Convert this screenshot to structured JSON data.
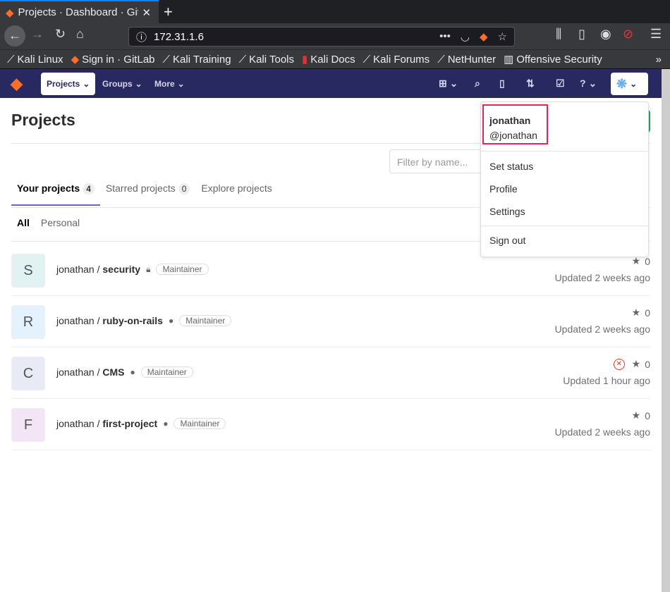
{
  "browser": {
    "tab_title": "Projects · Dashboard · GitLab",
    "url": "172.31.1.6",
    "bookmarks": [
      "Kali Linux",
      "Sign in · GitLab",
      "Kali Training",
      "Kali Tools",
      "Kali Docs",
      "Kali Forums",
      "NetHunter",
      "Offensive Security"
    ]
  },
  "header": {
    "projects": "Projects",
    "groups": "Groups",
    "more": "More"
  },
  "page": {
    "title": "Projects",
    "filter_placeholder": "Filter by name...",
    "tabs": [
      {
        "label": "Your projects",
        "count": "4"
      },
      {
        "label": "Starred projects",
        "count": "0"
      },
      {
        "label": "Explore projects"
      }
    ],
    "subtabs": [
      "All",
      "Personal"
    ]
  },
  "projects": [
    {
      "letter": "S",
      "namespace": "jonathan / ",
      "name": "security",
      "visibility": "lock",
      "role": "Maintainer",
      "stars": "0",
      "updated": "Updated 2 weeks ago",
      "avatar_bg": "#e0f2f1"
    },
    {
      "letter": "R",
      "namespace": "jonathan / ",
      "name": "ruby-on-rails",
      "visibility": "globe",
      "role": "Maintainer",
      "stars": "0",
      "updated": "Updated 2 weeks ago",
      "avatar_bg": "#e3f2fd"
    },
    {
      "letter": "C",
      "namespace": "jonathan / ",
      "name": "CMS",
      "visibility": "globe",
      "role": "Maintainer",
      "stars": "0",
      "updated": "Updated 1 hour ago",
      "avatar_bg": "#e8eaf6",
      "pipeline": "failed"
    },
    {
      "letter": "F",
      "namespace": "jonathan / ",
      "name": "first-project",
      "visibility": "globe",
      "role": "Maintainer",
      "stars": "0",
      "updated": "Updated 2 weeks ago",
      "avatar_bg": "#f3e5f5"
    }
  ],
  "user_menu": {
    "name": "jonathan",
    "username": "@jonathan",
    "items": [
      "Set status",
      "Profile",
      "Settings"
    ],
    "sign_out": "Sign out"
  },
  "colors": {
    "header": "#292961",
    "highlight": "#ee2255",
    "active_tab": "#6666c4"
  }
}
